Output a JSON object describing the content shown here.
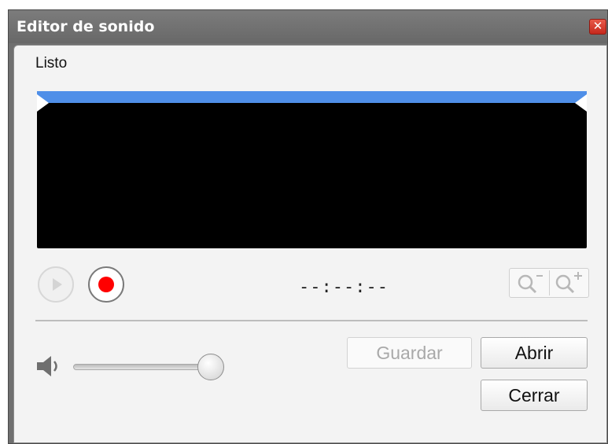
{
  "window": {
    "title": "Editor de sonido",
    "close_glyph": "✕"
  },
  "status": {
    "text": "Listo"
  },
  "playback": {
    "time_display": "--:--:--",
    "play_icon": "play-icon",
    "record_icon": "record-icon"
  },
  "zoom": {
    "out_icon": "zoom-out-icon",
    "in_icon": "zoom-in-icon"
  },
  "volume": {
    "icon": "speaker-icon",
    "level": 1.0
  },
  "buttons": {
    "save_label": "Guardar",
    "open_label": "Abrir",
    "close_label": "Cerrar"
  },
  "colors": {
    "wave_bar": "#4f8fe8",
    "record": "#ff0000",
    "titlebar": "#6f6f6f"
  }
}
